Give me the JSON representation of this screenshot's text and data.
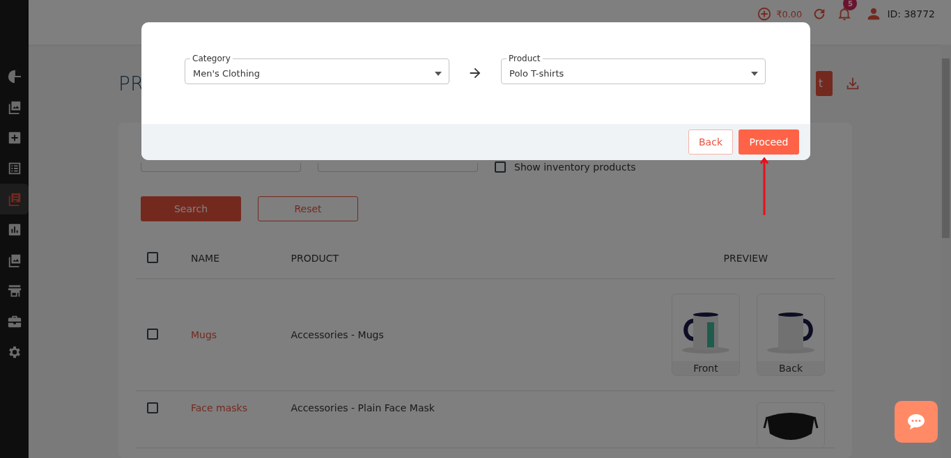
{
  "sidebar": {
    "items": [
      {
        "selected": false
      },
      {
        "selected": false
      },
      {
        "selected": false
      },
      {
        "selected": false
      },
      {
        "selected": true
      },
      {
        "selected": false
      },
      {
        "selected": false
      },
      {
        "selected": false
      },
      {
        "selected": false
      },
      {
        "selected": false
      }
    ]
  },
  "top_bar": {
    "balance": "₹0.00",
    "notifications_badge": "5",
    "user_id": "ID: 38772"
  },
  "page": {
    "title": "PR",
    "header_button": "t"
  },
  "filters": {
    "show_inventory": {
      "label": "Show inventory products",
      "checked": false
    },
    "search_button": "Search",
    "reset_button": "Reset"
  },
  "table": {
    "select_all_checked": false,
    "columns": [
      "NAME",
      "PRODUCT",
      "PREVIEW"
    ],
    "rows": [
      {
        "checked": false,
        "name": "Mugs",
        "product": "Accessories - Mugs",
        "previews": [
          {
            "label": "Front",
            "kind": "picture"
          },
          {
            "label": "Back",
            "kind": "picture"
          }
        ]
      },
      {
        "checked": false,
        "name": "Face masks",
        "product": "Accessories - Plain Face Mask"
      }
    ]
  },
  "dialog": {
    "category": {
      "label": "Category",
      "value": "Men's Clothing"
    },
    "product": {
      "label": "Product",
      "value": "Polo T-shirts"
    },
    "back_button": "Back",
    "proceed_button": "Proceed"
  }
}
